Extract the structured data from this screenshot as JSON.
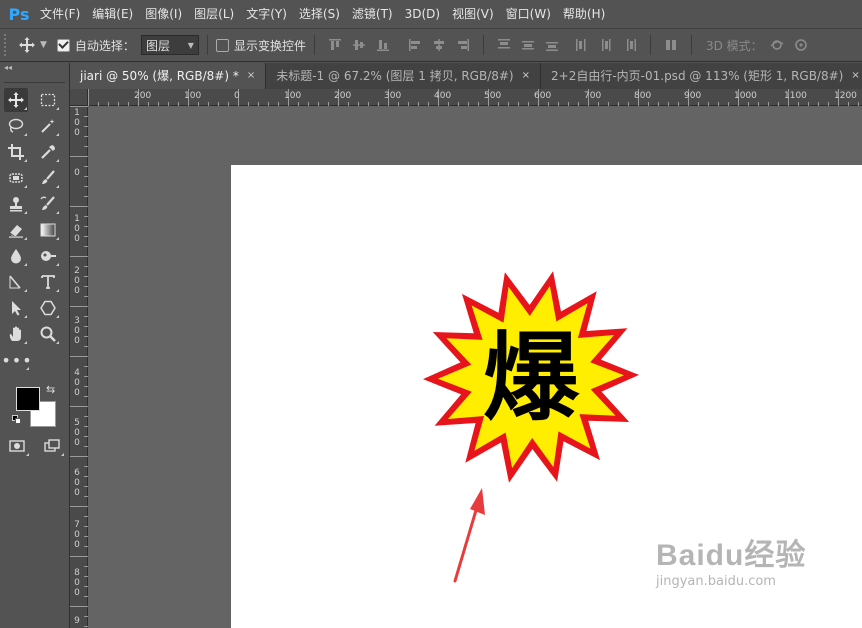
{
  "app": {
    "logo": "Ps"
  },
  "menu": [
    "文件(F)",
    "编辑(E)",
    "图像(I)",
    "图层(L)",
    "文字(Y)",
    "选择(S)",
    "滤镜(T)",
    "3D(D)",
    "视图(V)",
    "窗口(W)",
    "帮助(H)"
  ],
  "options": {
    "auto_select_label": "自动选择：",
    "auto_select_value": "图层",
    "show_transform_label": "显示变换控件",
    "mode3d_label": "3D 模式："
  },
  "tabs": [
    {
      "label": "jiari @ 50% (爆, RGB/8#) *",
      "active": true
    },
    {
      "label": "未标题-1 @ 67.2% (图层 1 拷贝, RGB/8#)",
      "active": false
    },
    {
      "label": "2+2自由行-内页-01.psd @ 113% (矩形 1, RGB/8#)",
      "active": false
    }
  ],
  "tab_close": "×",
  "toolbar_collapse": "◂◂",
  "ruler_h": [
    "200",
    "100",
    "0",
    "100",
    "200",
    "300",
    "400",
    "500",
    "600",
    "700",
    "800",
    "900",
    "1000",
    "1100",
    "1200"
  ],
  "ruler_v": [
    "100",
    "0",
    "100",
    "200",
    "300",
    "400",
    "500",
    "600",
    "700",
    "800",
    "9"
  ],
  "canvas": {
    "burst_char": "爆"
  },
  "colors": {
    "burst_outer": "#e8141b",
    "burst_inner": "#ffee00",
    "arrow": "#e83b3b",
    "foreground": "#000000",
    "background": "#ffffff"
  },
  "watermark": {
    "main": "Baidu经验",
    "sub": "jingyan.baidu.com"
  }
}
